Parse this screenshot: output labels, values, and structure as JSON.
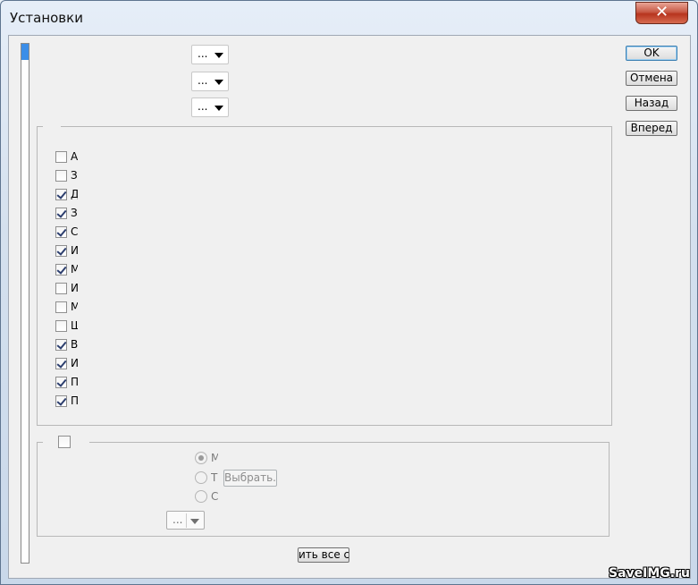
{
  "window": {
    "title": "Установки",
    "close_glyph": "✕"
  },
  "top_combos": [
    {
      "value": "..."
    },
    {
      "value": "..."
    },
    {
      "value": "..."
    }
  ],
  "checkboxes": [
    {
      "label": "А",
      "checked": false
    },
    {
      "label": "З",
      "checked": false
    },
    {
      "label": "Д",
      "checked": true
    },
    {
      "label": "З",
      "checked": true
    },
    {
      "label": "С",
      "checked": true
    },
    {
      "label": "И",
      "checked": true
    },
    {
      "label": "М",
      "checked": true
    },
    {
      "label": "И",
      "checked": false
    },
    {
      "label": "М",
      "checked": false
    },
    {
      "label": "Ш",
      "checked": false
    },
    {
      "label": "В",
      "checked": true
    },
    {
      "label": "И",
      "checked": true
    },
    {
      "label": "П",
      "checked": true
    },
    {
      "label": "П",
      "checked": true
    }
  ],
  "lower_group": {
    "checked": false,
    "radios": [
      {
        "label": "М",
        "selected": true
      },
      {
        "label": "Т",
        "selected": false
      },
      {
        "label": "С",
        "selected": false
      }
    ],
    "choose_button": "Выбрать...",
    "combo_value": "..."
  },
  "side_buttons": {
    "ok": "OK",
    "cancel": "Отмена",
    "back": "Назад",
    "forward": "Вперед"
  },
  "bottom_button": "ить все с",
  "watermark": "SaveIMG.ru"
}
